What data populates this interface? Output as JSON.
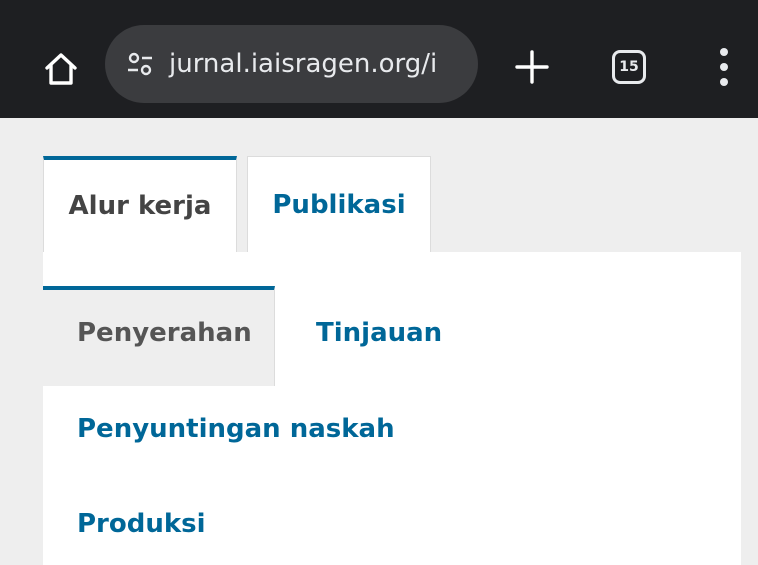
{
  "browser": {
    "url": "jurnal.iaisragen.org/i",
    "tab_count": "15",
    "icons": [
      "home-icon",
      "site-info-icon",
      "new-tab-plus-icon",
      "tab-switcher-icon",
      "overflow-menu-icon"
    ]
  },
  "workflow": {
    "main_tabs": [
      {
        "label": "Alur kerja",
        "active": true
      },
      {
        "label": "Publikasi",
        "active": false
      }
    ],
    "stages": [
      {
        "label": "Penyerahan",
        "active": true
      },
      {
        "label": "Tinjauan",
        "active": false
      },
      {
        "label": "Penyuntingan naskah",
        "active": false
      },
      {
        "label": "Produksi",
        "active": false
      }
    ]
  },
  "colors": {
    "toolbar_bg": "#1e1f22",
    "urlbar_bg": "#3b3c3f",
    "accent": "#006798",
    "page_bg": "#eeeeee"
  }
}
